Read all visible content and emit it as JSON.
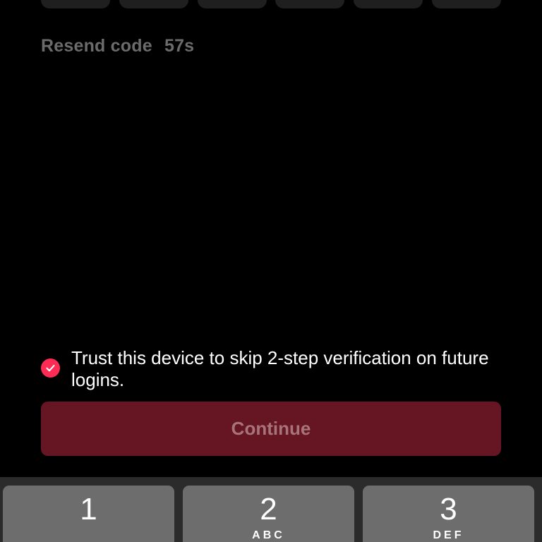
{
  "code_inputs": [
    "",
    "",
    "",
    "",
    "",
    ""
  ],
  "resend": {
    "label": "Resend code",
    "countdown": "57s"
  },
  "trust_device": {
    "checked": true,
    "label": "Trust this device to skip 2-step verification on future logins."
  },
  "continue_button": {
    "label": "Continue",
    "enabled": false
  },
  "keypad": {
    "keys": [
      {
        "digit": "1",
        "letters": ""
      },
      {
        "digit": "2",
        "letters": "ABC"
      },
      {
        "digit": "3",
        "letters": "DEF"
      }
    ]
  },
  "colors": {
    "background": "#000000",
    "accent": "#fe2c55",
    "continue_disabled_bg": "#661522",
    "continue_disabled_text": "#a7747c",
    "muted_text": "#6b6b6b",
    "key_bg": "#6d6d6d",
    "keyboard_bg": "#2b2b2b"
  }
}
